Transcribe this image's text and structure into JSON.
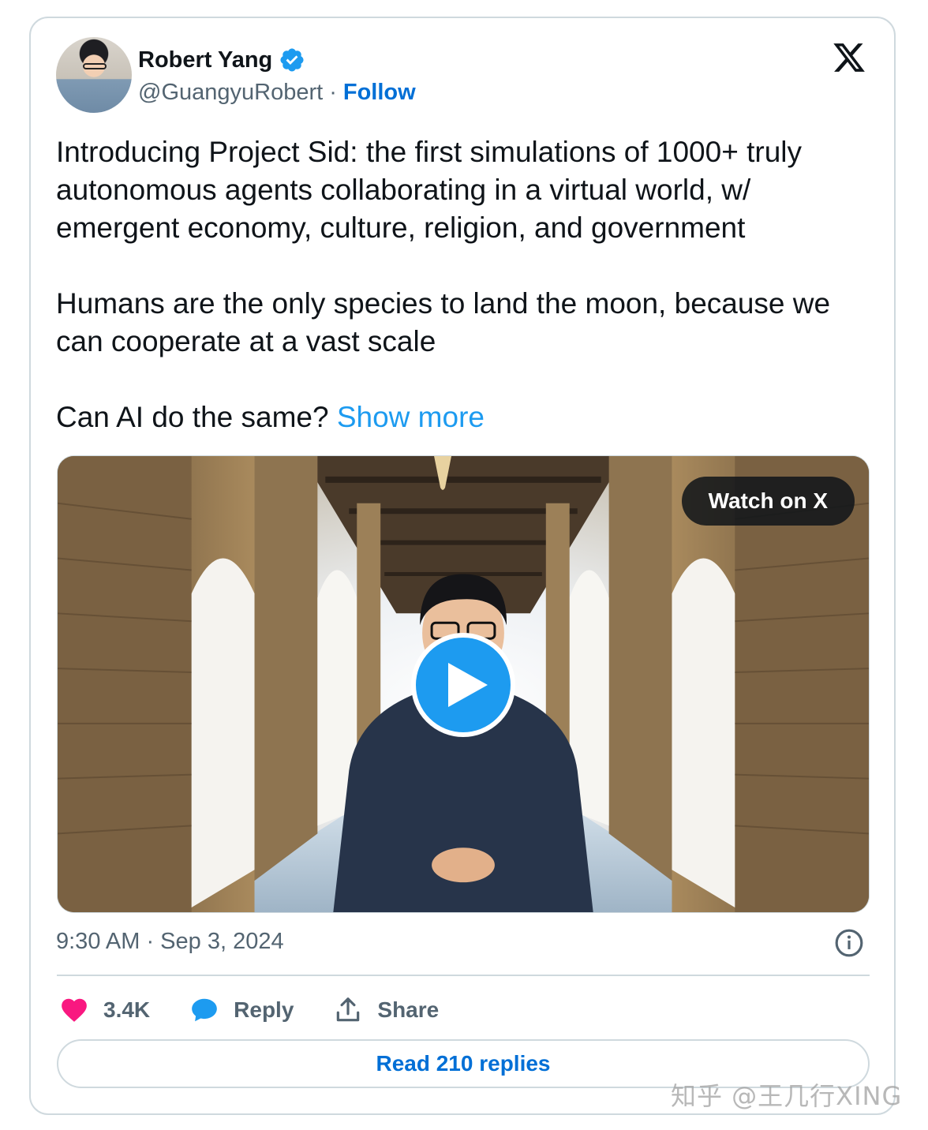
{
  "author": {
    "name": "Robert Yang",
    "handle": "@GuangyuRobert",
    "separator": "·",
    "follow_label": "Follow"
  },
  "tweet": {
    "paragraphs": [
      "Introducing Project Sid: the first simulations of 1000+ truly autonomous agents collaborating in a virtual world, w/ emergent economy, culture, religion, and government",
      "Humans are the only species to land the moon, because we can cooperate at a vast scale",
      "Can AI do the same?"
    ],
    "show_more_label": "Show more"
  },
  "media": {
    "watch_label": "Watch on X"
  },
  "timestamp": "9:30 AM · Sep 3, 2024",
  "actions": {
    "likes": "3.4K",
    "reply_label": "Reply",
    "share_label": "Share"
  },
  "read_replies_label": "Read 210 replies",
  "watermark": "知乎 @王几行XING",
  "colors": {
    "accent": "#1d9bf0",
    "link": "#006fd6",
    "like": "#f91880",
    "secondary_text": "#536471",
    "border": "#cfd9de"
  }
}
